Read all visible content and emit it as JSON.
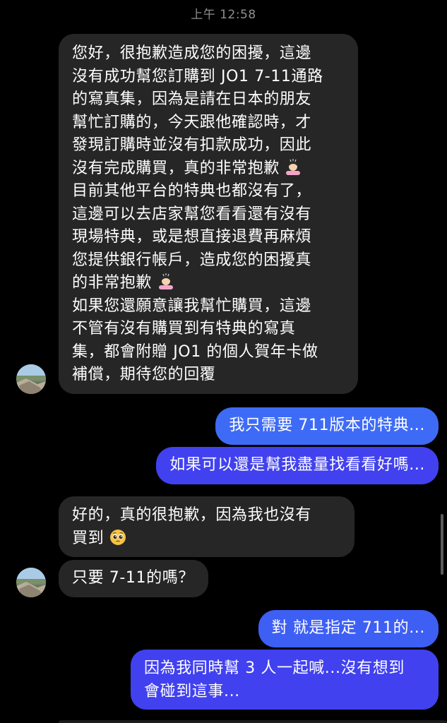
{
  "conversation": {
    "timestamp": "上午 12:58",
    "colors": {
      "background": "#000000",
      "incoming_bubble": "#262626",
      "outgoing_gradient_top": "#3c6df6",
      "outgoing_gradient_bottom": "#3f3ff0",
      "timestamp": "#8e8e93"
    }
  },
  "messages": [
    {
      "id": "m1",
      "direction": "incoming",
      "lines": [
        "您好，很抱歉造成您的困擾，這邊",
        "沒有成功幫您訂購到 JO1 7-11通路",
        "的寫真集，因為是請在日本的朋友",
        "幫忙訂購的，今天跟他確認時，才",
        "發現訂購時並沒有扣款成功，因此",
        "沒有完成購買，真的非常抱歉",
        "目前其他平台的特典也都沒有了，",
        "這邊可以去店家幫您看看還有沒有",
        "現場特典，或是想直接退費再麻煩",
        "您提供銀行帳戶，造成您的困擾真",
        "的非常抱歉",
        "如果您還願意讓我幫忙購買，這邊",
        "不管有沒有購買到有特典的寫真",
        "集，都會附贈 JO1 的個人賀年卡做",
        "補償，期待您的回覆"
      ],
      "emoji_lines": {
        "5": "person-bowing-emoji",
        "10": "person-bowing-emoji"
      }
    },
    {
      "id": "m2",
      "direction": "outgoing",
      "text": "我只需要 711版本的特典..."
    },
    {
      "id": "m3",
      "direction": "outgoing",
      "text": "如果可以還是幫我盡量找看看好嗎..."
    },
    {
      "id": "m4",
      "direction": "incoming",
      "lines": [
        "好的，真的很抱歉，因為我也沒有",
        "買到"
      ],
      "emoji_lines": {
        "1": "pleading-face-emoji"
      }
    },
    {
      "id": "m5",
      "direction": "incoming",
      "text": "只要 7-11的嗎？"
    },
    {
      "id": "m6",
      "direction": "outgoing",
      "text": "對 就是指定 711的..."
    },
    {
      "id": "m7",
      "direction": "outgoing",
      "lines": [
        "因為我同時幫 3 人一起喊...沒有想到",
        "會碰到這事..."
      ]
    }
  ]
}
